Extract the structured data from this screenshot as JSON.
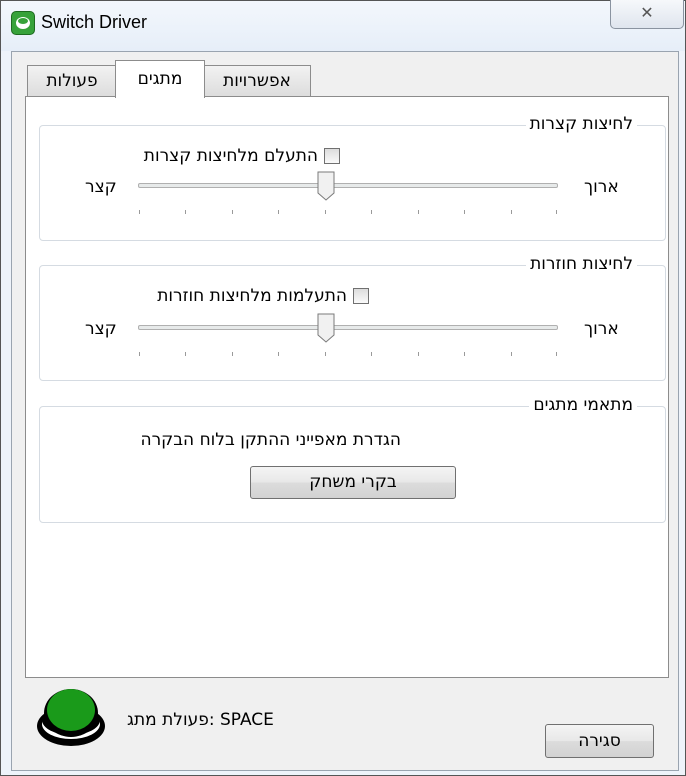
{
  "window": {
    "title": "Switch Driver",
    "close_glyph": "✕"
  },
  "tabs": [
    {
      "label": "אפשרויות",
      "active": false
    },
    {
      "label": "מתגים",
      "active": true
    },
    {
      "label": "פעולות",
      "active": false
    }
  ],
  "short_press": {
    "title": "לחיצות קצרות",
    "checkbox_label": "התעלם מלחיצות קצרות",
    "checked": false,
    "min_label": "קצר",
    "max_label": "ארוך",
    "slider_value": 0.45
  },
  "long_press": {
    "title": "לחיצות חוזרות",
    "checkbox_label": "התעלמות מלחיצות חוזרות",
    "checked": false,
    "min_label": "קצר",
    "max_label": "ארוך",
    "slider_value": 0.45
  },
  "adapters": {
    "title": "מתאמי מתגים",
    "description": "הגדרת מאפייני ההתקן בלוח הבקרה",
    "button_label": "בקרי משחק"
  },
  "footer": {
    "switch_action": "SPACE :פעולת מתג",
    "close_button": "סגירה",
    "switch_color": "#1a9a1a"
  }
}
